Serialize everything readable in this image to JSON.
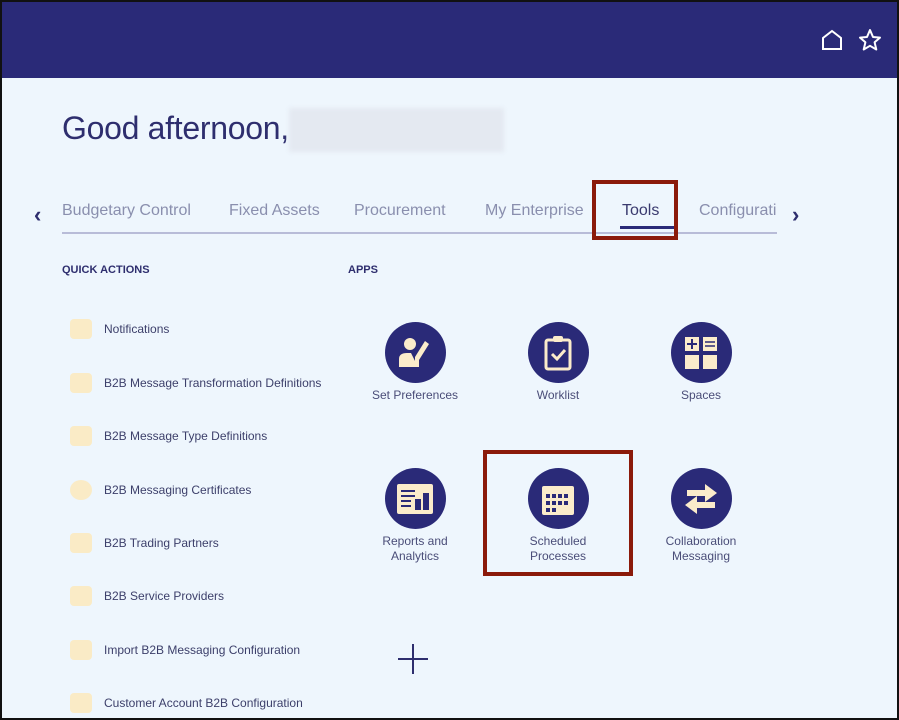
{
  "header": {
    "icons": [
      "home-icon",
      "star-icon"
    ]
  },
  "greeting": "Good afternoon,",
  "tabs": [
    {
      "label": "Budgetary Control"
    },
    {
      "label": "Fixed Assets"
    },
    {
      "label": "Procurement"
    },
    {
      "label": "My Enterprise"
    },
    {
      "label": "Tools",
      "selected": true
    },
    {
      "label": "Configuratio"
    }
  ],
  "quick_actions": {
    "title": "QUICK ACTIONS",
    "items": [
      "Notifications",
      "B2B Message Transformation Definitions",
      "B2B Message Type Definitions",
      "B2B Messaging Certificates",
      "B2B Trading Partners",
      "B2B Service Providers",
      "Import B2B Messaging Configuration",
      "Customer Account B2B Configuration"
    ]
  },
  "apps": {
    "title": "APPS",
    "items": [
      {
        "l1": "Set Preferences",
        "l2": ""
      },
      {
        "l1": "Worklist",
        "l2": ""
      },
      {
        "l1": "Spaces",
        "l2": ""
      },
      {
        "l1": "Reports and",
        "l2": "Analytics"
      },
      {
        "l1": "Scheduled",
        "l2": "Processes"
      },
      {
        "l1": "Collaboration",
        "l2": "Messaging"
      }
    ]
  },
  "colors": {
    "header": "#2a2a78",
    "highlight": "#8b1a0a",
    "icon_fill": "#fbeccb"
  }
}
